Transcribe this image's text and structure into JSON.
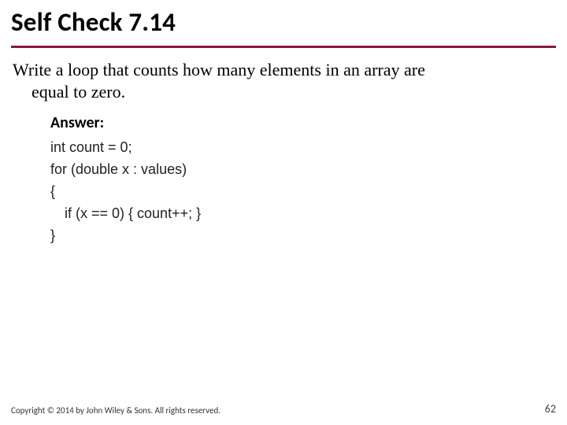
{
  "title": "Self Check 7.14",
  "prompt": {
    "line1": "Write a loop that counts how many elements in an array are",
    "line2": "equal to zero."
  },
  "answer_label": "Answer:",
  "code": {
    "l1": "int count = 0;",
    "l2": "for (double x : values)",
    "l3": "{",
    "l4": "if (x == 0) { count++; }",
    "l5": "}"
  },
  "footer": {
    "copyright": "Copyright © 2014 by John Wiley & Sons. All rights reserved.",
    "page": "62"
  }
}
